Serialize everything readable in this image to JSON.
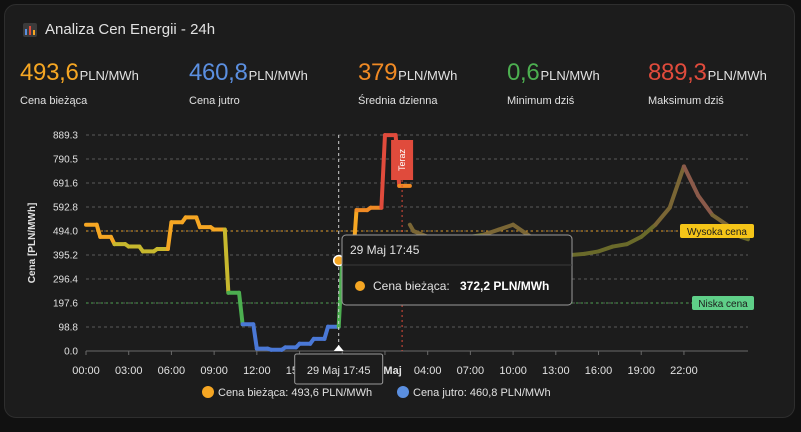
{
  "header": {
    "title": "Analiza Cen Energii - 24h",
    "icon": "bar-chart-icon"
  },
  "stats": [
    {
      "value": "493,6",
      "unit": "PLN/MWh",
      "label": "Cena bieżąca",
      "color": "#f5a623"
    },
    {
      "value": "460,8",
      "unit": "PLN/MWh",
      "label": "Cena jutro",
      "color": "#5b8fe0"
    },
    {
      "value": "379",
      "unit": "PLN/MWh",
      "label": "Średnia dzienna",
      "color": "#f08a24"
    },
    {
      "value": "0,6",
      "unit": "PLN/MWh",
      "label": "Minimum dziś",
      "color": "#4caf50"
    },
    {
      "value": "889,3",
      "unit": "PLN/MWh",
      "label": "Maksimum dziś",
      "color": "#e04b3c"
    }
  ],
  "chart_data": {
    "type": "line",
    "ylabel": "Cena [PLN/MWh]",
    "ylim": [
      0,
      889.3
    ],
    "y_ticks": [
      "0.0",
      "98.8",
      "197.6",
      "296.4",
      "395.2",
      "494.0",
      "592.8",
      "691.6",
      "790.5",
      "889.3"
    ],
    "x_ticks": [
      "00:00",
      "03:00",
      "06:00",
      "09:00",
      "12:00",
      "15:00",
      "18:00",
      "30 Maj",
      "04:00",
      "07:00",
      "10:00",
      "13:00",
      "16:00",
      "19:00",
      "22:00"
    ],
    "x_range_hours": [
      0,
      46.5
    ],
    "grid": true,
    "series": [
      {
        "name": "Cena bieżąca",
        "label": "Cena bieżąca: 493,6 PLN/MWh",
        "color": "#f5a623",
        "x": [
          0,
          0.75,
          1,
          1.75,
          2,
          2.75,
          3,
          3.75,
          4,
          4.75,
          5,
          5.75,
          6,
          6.75,
          7,
          7.75,
          8,
          8.75,
          9,
          9.75,
          10,
          10.75,
          11,
          11.75,
          12,
          12.75,
          13,
          13.75,
          14,
          14.75,
          15,
          15.75,
          16,
          16.75,
          17,
          17.75,
          18,
          18.75,
          19,
          19.75,
          20,
          20.75,
          21,
          21.75,
          22,
          22.75
        ],
        "y": [
          520,
          520,
          470,
          470,
          440,
          440,
          430,
          430,
          410,
          410,
          420,
          420,
          530,
          530,
          550,
          550,
          510,
          510,
          500,
          500,
          240,
          240,
          110,
          110,
          10,
          10,
          5,
          5,
          15,
          15,
          30,
          30,
          50,
          50,
          100,
          100,
          372,
          372,
          580,
          580,
          590,
          590,
          889,
          889,
          680,
          680
        ]
      },
      {
        "name": "Cena jutro",
        "label": "Cena jutro: 460,8 PLN/MWh",
        "color": "#5b8fe0",
        "x": [
          22.75,
          23,
          24,
          25,
          26,
          27,
          28,
          29,
          30,
          31,
          32,
          33,
          34,
          35,
          36,
          37,
          38,
          39,
          40,
          41,
          42,
          43,
          44,
          45,
          46,
          46.5
        ],
        "y": [
          520,
          494,
          470,
          460,
          460,
          470,
          480,
          500,
          520,
          480,
          440,
          420,
          395,
          400,
          410,
          430,
          440,
          470,
          520,
          590,
          760,
          640,
          560,
          520,
          470,
          460
        ]
      }
    ],
    "thresholds": [
      {
        "label": "Wysoka cena",
        "value": 494.0,
        "color": "#f5a623"
      },
      {
        "label": "Niska cena",
        "value": 197.6,
        "color": "#4caf50"
      }
    ],
    "now_marker": {
      "label": "Teraz",
      "x": 21.5
    },
    "tooltip": {
      "title": "29 Maj 17:45",
      "series": "Cena bieżąca:",
      "value": "372,2 PLN/MWh",
      "x": 17.75,
      "y": 372.2
    },
    "crosshair_label": "29 Maj 17:45"
  }
}
